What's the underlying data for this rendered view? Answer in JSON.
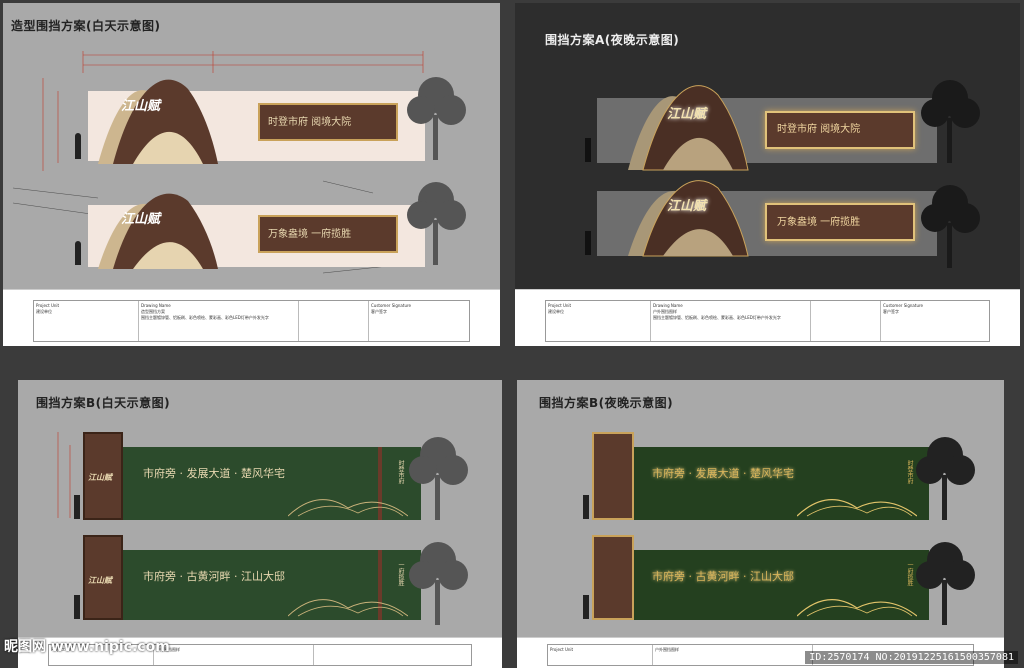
{
  "sheets": {
    "a_day": {
      "title": "造型围挡方案(白天示意图)"
    },
    "a_night": {
      "title": "围挡方案A(夜晚示意图)"
    },
    "b_day": {
      "title": "围挡方案B(白天示意图)"
    },
    "b_night": {
      "title": "围挡方案B(夜晚示意图)"
    }
  },
  "plan_a": {
    "logo": "江山赋",
    "scroll_1": "时登市府  阅境大院",
    "scroll_2": "万象盎境  一府揽胜"
  },
  "plan_b": {
    "logo": "江山赋",
    "board_1_main": "市府旁 · 发展大道 · 楚风华宅",
    "board_2_main": "市府旁 · 古黄河畔 · 江山大邸",
    "board_1_side": "时登市府",
    "board_1_side2": "阅境大院",
    "board_2_side": "一府揽胜",
    "board_2_side2": "万象盎境"
  },
  "titleblock": {
    "project_unit": "Project Unit",
    "project_unit_cn": "建设单位",
    "project_name": "Project Name",
    "project_name_cn": "工程名称",
    "drawing_name": "Drawing Name",
    "drawing_name_cn": "图纸名称",
    "drawing_value_a": "造型围挡方案",
    "drawing_value_b": "户外围挡图样",
    "material": "Material & Technology",
    "material_cn": "材料工艺",
    "material_value": "围挡主题镀锌管、铝板刷、彩色喷绘、蒙彩画、彩色LED灯带户外发光字",
    "signature": "Customer Signature",
    "signature_cn": "客户签字"
  },
  "watermark": {
    "left": "昵图网 www.nipic.com",
    "id": "ID:2570174 NO:20191225161500357081"
  },
  "colors": {
    "brown": "#5b3a2c",
    "tan": "#cdb68f",
    "green": "#2c4b2c",
    "gold": "#c9a25a",
    "sheet_day": "#a9a9a9",
    "sheet_night": "#2d2d2d"
  }
}
